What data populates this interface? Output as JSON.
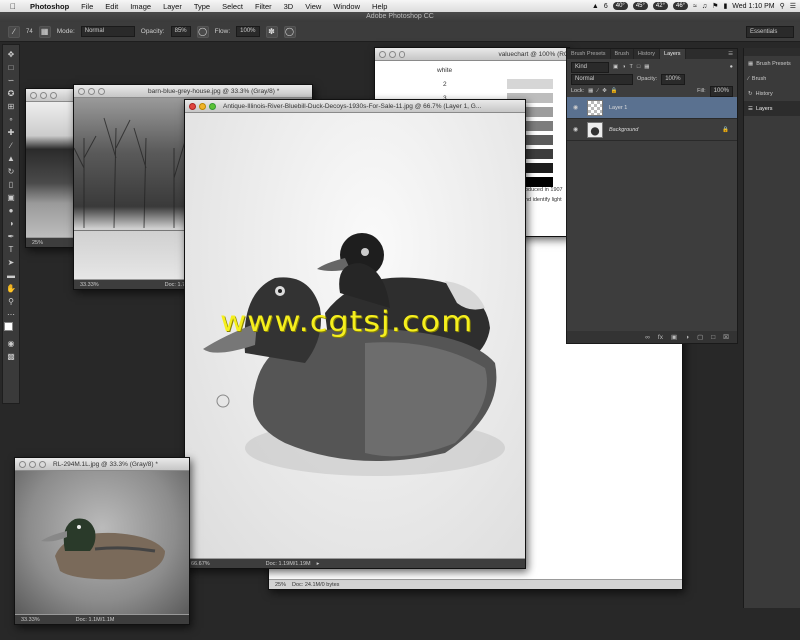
{
  "menubar": {
    "app": "Photoshop",
    "items": [
      "File",
      "Edit",
      "Image",
      "Layer",
      "Type",
      "Select",
      "Filter",
      "3D",
      "View",
      "Window",
      "Help"
    ],
    "status": {
      "badge_count": "6",
      "temp1": "40°",
      "temp2": "45°",
      "temp3": "42°",
      "temp4": "46°",
      "clock": "Wed 1:10 PM"
    }
  },
  "app_title": "Adobe Photoshop CC",
  "options": {
    "mode_label": "Mode:",
    "mode_value": "Normal",
    "opacity_label": "Opacity:",
    "opacity_value": "85%",
    "flow_label": "Flow:",
    "flow_value": "100%",
    "workspace": "Essentials",
    "brush_size": "74"
  },
  "windows": {
    "valuechart": {
      "title": "valuechart @ 100% (RG",
      "chart_title": "white",
      "numbers": [
        "2",
        "3"
      ],
      "text1": "oduced in 1907",
      "text2": "nd identify light"
    },
    "barn": {
      "title": "barn-blue-grey-house.jpg @ 33.3% (Gray/8) *",
      "zoom": "33.33%",
      "doc": "Doc: 1.79M/1.79M"
    },
    "left_small": {
      "zoom": "25%"
    },
    "big_bg": {
      "zoom": "25%",
      "doc": "Doc: 24.1M/0 bytes"
    },
    "decoys": {
      "title": "Antique-Illinois-River-Bluebill-Duck-Decoys-1930s-For-Sale-11.jpg @ 66.7% (Layer 1, G...",
      "zoom": "66.67%",
      "doc": "Doc: 1.19M/1.19M"
    },
    "rl": {
      "title": "RL-294M.1L.jpg @ 33.3% (Gray/8) *",
      "zoom": "33.33%",
      "doc": "Doc: 1.1M/1.1M"
    }
  },
  "layers_panel": {
    "tabs": [
      "Brush Presets",
      "Brush",
      "History",
      "Layers"
    ],
    "kind": "Kind",
    "blend": "Normal",
    "opacity_label": "Opacity:",
    "opacity_value": "100%",
    "lock_label": "Lock:",
    "fill_label": "Fill:",
    "fill_value": "100%",
    "layers": [
      {
        "name": "Layer 1",
        "selected": true
      },
      {
        "name": "Background",
        "selected": false
      }
    ]
  },
  "dock": {
    "items": [
      "Brush Presets",
      "Brush",
      "History",
      "Layers"
    ]
  },
  "watermark": "www.cgtsj.com",
  "colors": {
    "selection": "#5a7190",
    "watermark": "#f5ef1e"
  }
}
